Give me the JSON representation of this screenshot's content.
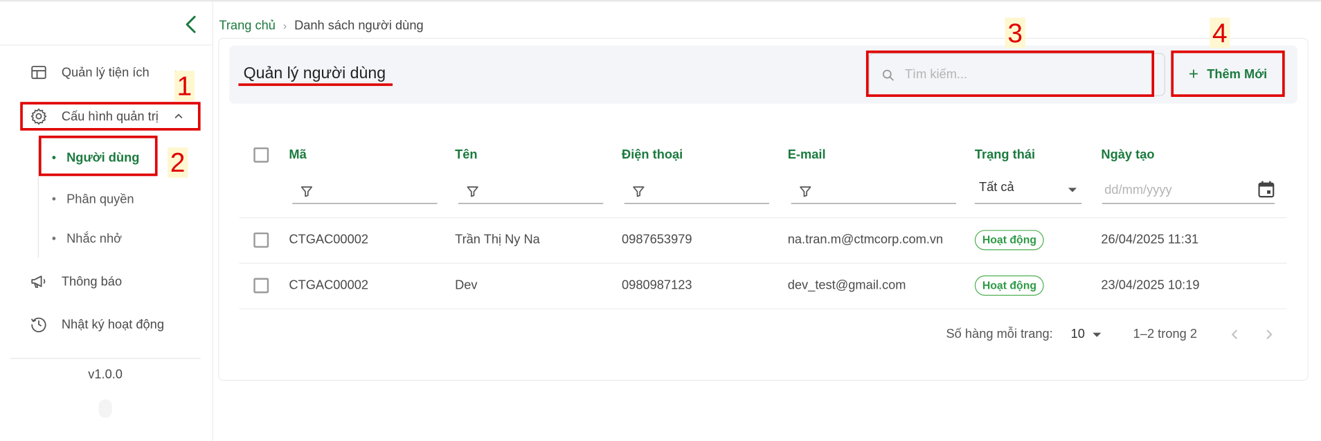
{
  "sidebar": {
    "items": [
      {
        "label": "Quản lý tiện ích",
        "icon": "layout-icon"
      },
      {
        "label": "Cấu hình quản trị",
        "icon": "gear-icon"
      },
      {
        "label": "Thông báo",
        "icon": "megaphone-icon"
      },
      {
        "label": "Nhật ký hoạt động",
        "icon": "history-icon"
      }
    ],
    "subitems": [
      {
        "label": "Người dùng",
        "active": true
      },
      {
        "label": "Phân quyền"
      },
      {
        "label": "Nhắc nhở"
      }
    ],
    "version": "v1.0.0"
  },
  "breadcrumb": {
    "home": "Trang chủ",
    "separator": "›",
    "current": "Danh sách người dùng"
  },
  "page": {
    "title": "Quản lý người dùng"
  },
  "search": {
    "placeholder": "Tìm kiếm..."
  },
  "add_button": {
    "label": "Thêm Mới"
  },
  "annotations": [
    "1",
    "2",
    "3",
    "4"
  ],
  "table": {
    "headers": {
      "code": "Mã",
      "name": "Tên",
      "phone": "Điện thoại",
      "email": "E-mail",
      "status": "Trạng thái",
      "created": "Ngày tạo"
    },
    "filters": {
      "status_value": "Tất cả",
      "date_placeholder": "dd/mm/yyyy"
    },
    "rows": [
      {
        "code": "CTGAC00002",
        "name": "Trần Thị Ny Na",
        "phone": "0987653979",
        "email": "na.tran.m@ctmcorp.com.vn",
        "status": "Hoạt động",
        "created": "26/04/2025 11:31"
      },
      {
        "code": "CTGAC00002",
        "name": "Dev",
        "phone": "0980987123",
        "email": "dev_test@gmail.com",
        "status": "Hoạt động",
        "created": "23/04/2025 10:19"
      }
    ]
  },
  "pagination": {
    "rows_per_page_label": "Số hàng mỗi trang:",
    "rows_per_page": "10",
    "range": "1–2 trong 2"
  },
  "colors": {
    "accent": "#1b7a3e",
    "annotation": "#e00000",
    "status_active": "#4caf50"
  }
}
